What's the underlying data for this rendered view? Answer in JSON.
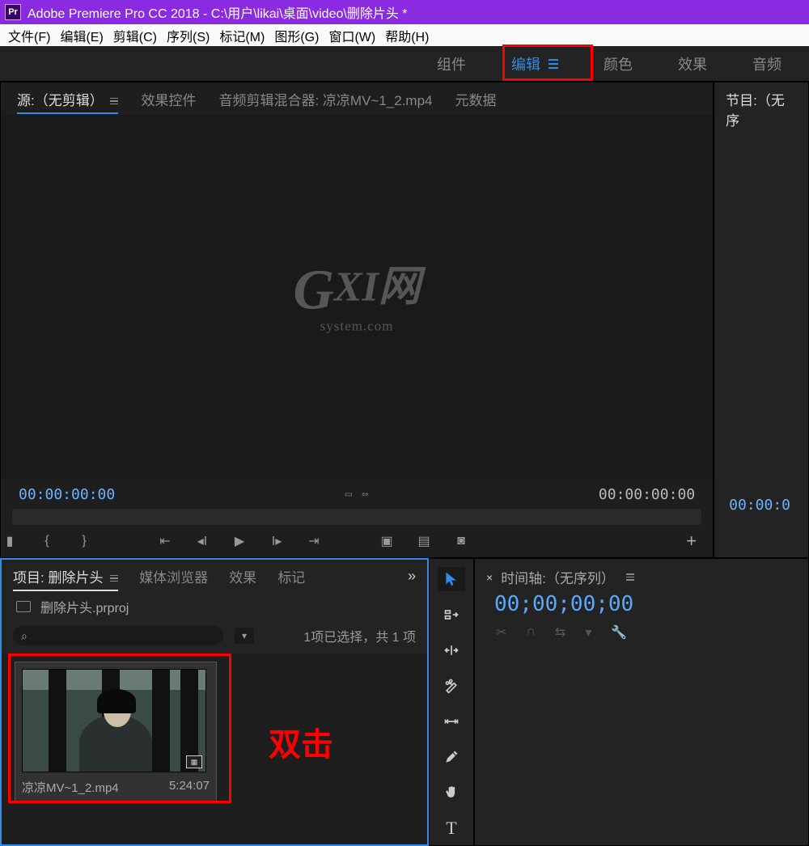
{
  "title_bar": {
    "app_icon_text": "Pr",
    "title": "Adobe Premiere Pro CC 2018 - C:\\用户\\likai\\桌面\\video\\删除片头 *"
  },
  "menu": {
    "file": "文件(F)",
    "edit": "编辑(E)",
    "clip": "剪辑(C)",
    "sequence": "序列(S)",
    "marker": "标记(M)",
    "graphics": "图形(G)",
    "window": "窗口(W)",
    "help": "帮助(H)"
  },
  "workspaces": {
    "assembly": "组件",
    "editing": "编辑",
    "color": "颜色",
    "effects": "效果",
    "audio": "音频"
  },
  "source_panel": {
    "tab_source": "源:（无剪辑）",
    "tab_effect_controls": "效果控件",
    "tab_audio_mixer": "音频剪辑混合器: 凉凉MV~1_2.mp4",
    "tab_metadata": "元数据",
    "tc_left": "00:00:00:00",
    "tc_right": "00:00:00:00"
  },
  "program_panel": {
    "tab_program": "节目:（无序",
    "tc_left": "00:00:0"
  },
  "watermark": {
    "main": "GXI网",
    "sub": "system.com"
  },
  "project_panel": {
    "tab_project": "项目: 删除片头",
    "tab_media_browser": "媒体浏览器",
    "tab_effects": "效果",
    "tab_markers": "标记",
    "chevron": "»",
    "project_filename": "删除片头.prproj",
    "search_placeholder": "",
    "selection_info": "1项已选择，共 1 项",
    "clip": {
      "name": "凉凉MV~1_2.mp4",
      "duration": "5:24:07"
    },
    "double_click_label": "双击"
  },
  "timeline_panel": {
    "tab_label": "时间轴:（无序列）",
    "close_x": "×",
    "tc": "00;00;00;00"
  },
  "icons": {
    "search": "⌕",
    "filter": "▭",
    "marker": "◆",
    "in": "{",
    "out": "}",
    "goto_in": "⇤",
    "step_back": "◀I",
    "play": "▶",
    "step_fwd": "I▶",
    "goto_out": "⇥",
    "insert": "▣",
    "overwrite": "▦",
    "camera": "◉",
    "plus": "+",
    "magnet": "∩",
    "link": "⇋",
    "wrench": "🔧",
    "tag": "●"
  }
}
